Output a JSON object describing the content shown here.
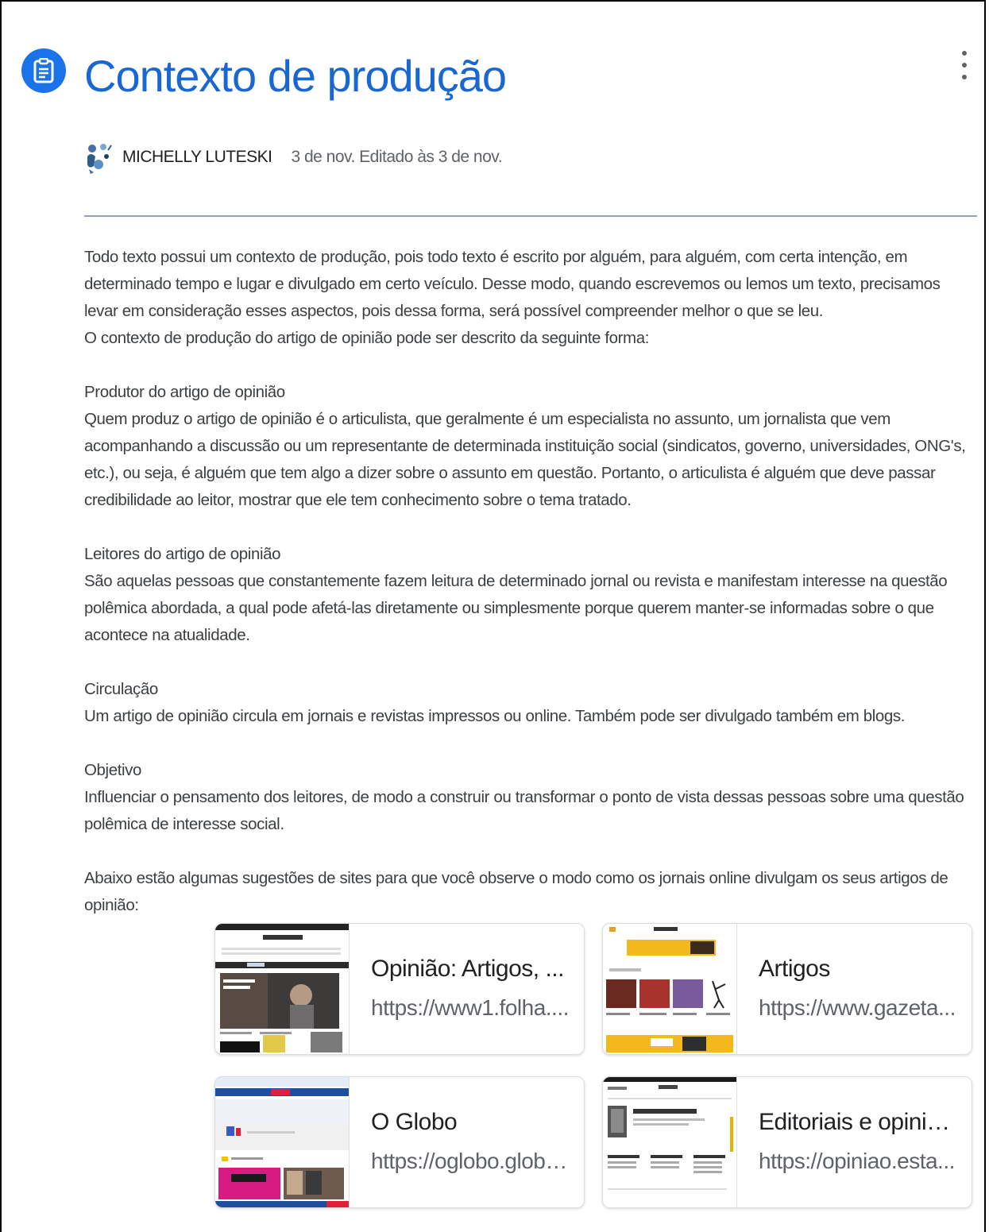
{
  "header": {
    "title": "Contexto de produção",
    "icon": "assignment-icon",
    "accent_color": "#1a73e8"
  },
  "meta": {
    "author": "MICHELLY LUTESKI",
    "date": "3 de nov. Editado às 3 de nov."
  },
  "content": {
    "intro_1": "Todo texto possui um contexto de produção, pois todo texto é escrito por alguém, para alguém, com certa intenção, em determinado tempo e lugar e divulgado em certo veículo. Desse modo, quando escrevemos ou lemos um texto, precisamos levar em consideração esses aspectos, pois dessa forma, será possível compreender melhor o que se leu.",
    "intro_2": "O contexto de produção do artigo de opinião pode ser descrito da seguinte forma:",
    "sections": [
      {
        "heading": "Produtor do artigo de opinião",
        "text": "Quem produz o artigo de opinião é o articulista, que geralmente é um especialista no assunto, um jornalista que vem acompanhando a discussão ou um representante de determinada instituição social (sindicatos, governo, universidades, ONG's, etc.), ou seja, é alguém que tem algo a dizer sobre o assunto em questão. Portanto, o articulista é alguém que deve passar credibilidade ao leitor, mostrar que ele tem conhecimento sobre o tema tratado."
      },
      {
        "heading": "Leitores do artigo de opinião",
        "text": "São aquelas pessoas que constantemente fazem leitura de determinado jornal ou revista e manifestam interesse na questão polêmica abordada, a qual pode afetá-las diretamente ou simplesmente porque querem manter-se informadas sobre o que acontece na atualidade."
      },
      {
        "heading": "Circulação",
        "text": "Um artigo de opinião circula em jornais e revistas impressos ou online. Também pode ser divulgado também em blogs."
      },
      {
        "heading": "Objetivo",
        "text": "Influenciar o pensamento dos leitores, de modo a construir ou transformar o ponto de vista dessas pessoas sobre uma questão polêmica de interesse social."
      }
    ],
    "closing": "Abaixo estão algumas sugestões de sites para que você observe o modo como os jornais online divulgam os seus artigos de opinião:"
  },
  "links": [
    {
      "title": "Opinião: Artigos, ...",
      "url": "https://www1.folha...."
    },
    {
      "title": "Artigos",
      "url": "https://www.gazeta..."
    },
    {
      "title": "O Globo",
      "url": "https://oglobo.globo..."
    },
    {
      "title": "Editoriais e opiniã...",
      "url": "https://opiniao.esta..."
    }
  ]
}
